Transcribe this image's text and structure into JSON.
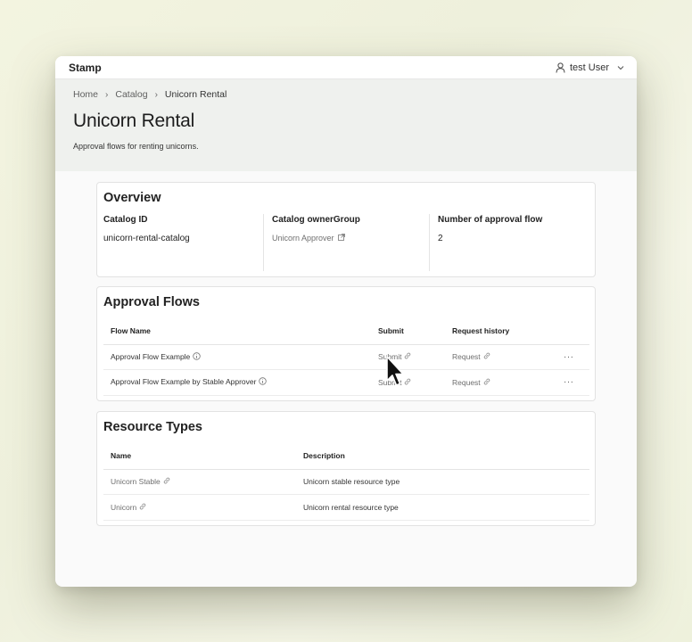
{
  "app": {
    "brand": "Stamp",
    "user_name": "test User"
  },
  "breadcrumb": [
    "Home",
    "Catalog",
    "Unicorn Rental"
  ],
  "page": {
    "title": "Unicorn Rental",
    "description": "Approval flows for renting unicorns."
  },
  "overview": {
    "heading": "Overview",
    "catalog_id_label": "Catalog ID",
    "catalog_id_value": "unicorn-rental-catalog",
    "owner_group_label": "Catalog ownerGroup",
    "owner_group_value": "Unicorn Approver",
    "approval_flow_count_label": "Number of approval flow",
    "approval_flow_count_value": "2"
  },
  "approval_flows": {
    "heading": "Approval Flows",
    "columns": [
      "Flow Name",
      "Submit",
      "Request history"
    ],
    "rows": [
      {
        "name": "Approval Flow Example",
        "submit": "Submit",
        "history": "Request",
        "more": "···"
      },
      {
        "name": "Approval Flow Example by Stable Approver",
        "submit": "Submit",
        "history": "Request",
        "more": "···"
      }
    ]
  },
  "resource_types": {
    "heading": "Resource Types",
    "columns": [
      "Name",
      "Description"
    ],
    "rows": [
      {
        "name": "Unicorn Stable",
        "description": "Unicorn stable resource type"
      },
      {
        "name": "Unicorn",
        "description": "Unicorn rental resource type"
      }
    ]
  },
  "icons": {
    "user": "user-icon",
    "chevron": "chevron-down-icon",
    "breadcrumb_sep": "chevron-right-icon",
    "external": "external-link-icon",
    "info": "info-icon",
    "link": "link-icon",
    "more": "more-icon",
    "cursor": "mouse-pointer-icon"
  }
}
